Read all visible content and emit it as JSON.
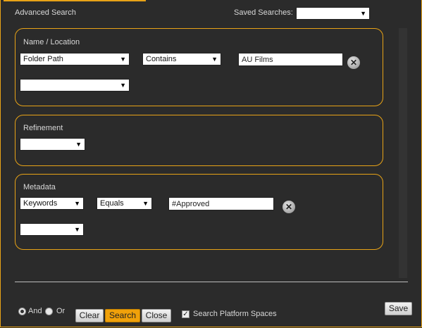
{
  "header": {
    "title": "Advanced Search",
    "saved_searches_label": "Saved Searches:",
    "saved_searches_value": ""
  },
  "sections": {
    "name_location": {
      "title": "Name / Location",
      "field": "Folder Path",
      "operator": "Contains",
      "value": "AU Films",
      "extra_select": ""
    },
    "refinement": {
      "title": "Refinement",
      "select": ""
    },
    "metadata": {
      "title": "Metadata",
      "field": "Keywords",
      "operator": "Equals",
      "value": "#Approved",
      "extra_select": ""
    }
  },
  "footer": {
    "and_label": "And",
    "or_label": "Or",
    "logic_selected": "And",
    "clear_label": "Clear",
    "search_label": "Search",
    "close_label": "Close",
    "platform_spaces_label": "Search Platform Spaces",
    "platform_spaces_checked": true,
    "save_label": "Save"
  },
  "icons": {
    "dropdown": "chevron-down-icon",
    "remove": "close-circle-icon",
    "check": "checkmark-icon"
  },
  "colors": {
    "accent": "#e8a317",
    "background": "#2b2b2b",
    "primary_button": "#f0a10a"
  }
}
